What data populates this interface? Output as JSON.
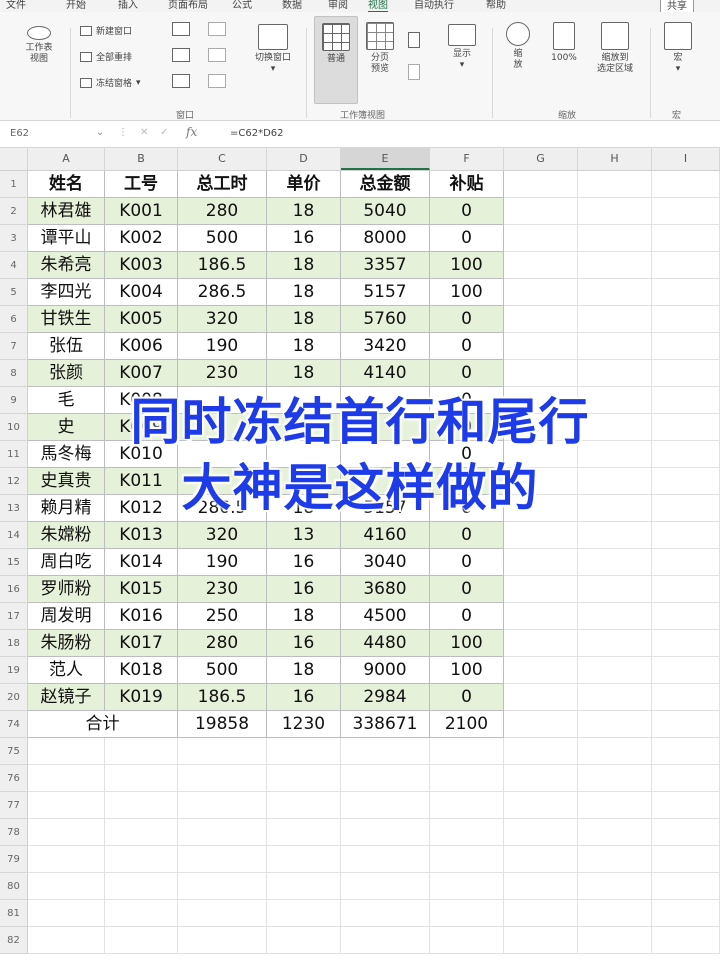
{
  "ribbon": {
    "tabs": [
      "文件",
      "开始",
      "插入",
      "页面布局",
      "公式",
      "数据",
      "审阅",
      "视图",
      "自动执行",
      "帮助"
    ],
    "active_tab": "视图",
    "right_button": "共享",
    "buttons": {
      "sheet_view": "工作表\n视图",
      "new_window": "新建窗口",
      "arrange_all": "全部重排",
      "freeze_panes": "冻结窗格",
      "switch_window": "切换窗口",
      "normal": "普通",
      "page_break": "分页\n预览",
      "show": "显示",
      "zoom": "缩\n放",
      "zoom_100": "100%",
      "zoom_selection": "缩放到\n选定区域",
      "macros": "宏"
    },
    "groups": {
      "window": "窗口",
      "workbook_views": "工作簿视图",
      "zoom": "缩放",
      "macros": "宏"
    }
  },
  "formula_bar": {
    "name_box": "E62",
    "fx": "fx",
    "formula": "=C62*D62"
  },
  "sheet": {
    "column_letters": [
      "A",
      "B",
      "C",
      "D",
      "E",
      "F",
      "G",
      "H",
      "I"
    ],
    "header_row_number": "1",
    "headers": [
      "姓名",
      "工号",
      "总工时",
      "单价",
      "总金额",
      "补贴"
    ],
    "rows": [
      {
        "n": "2",
        "cells": [
          "林君雄",
          "K001",
          "280",
          "18",
          "5040",
          "0"
        ]
      },
      {
        "n": "3",
        "cells": [
          "谭平山",
          "K002",
          "500",
          "16",
          "8000",
          "0"
        ]
      },
      {
        "n": "4",
        "cells": [
          "朱希亮",
          "K003",
          "186.5",
          "18",
          "3357",
          "100"
        ]
      },
      {
        "n": "5",
        "cells": [
          "李四光",
          "K004",
          "286.5",
          "18",
          "5157",
          "100"
        ]
      },
      {
        "n": "6",
        "cells": [
          "甘铁生",
          "K005",
          "320",
          "18",
          "5760",
          "0"
        ]
      },
      {
        "n": "7",
        "cells": [
          "张伍",
          "K006",
          "190",
          "18",
          "3420",
          "0"
        ]
      },
      {
        "n": "8",
        "cells": [
          "张颜",
          "K007",
          "230",
          "18",
          "4140",
          "0"
        ]
      },
      {
        "n": "9",
        "cells": [
          "毛",
          "K008",
          "",
          "",
          "",
          "0"
        ]
      },
      {
        "n": "10",
        "cells": [
          "史",
          "K009",
          "",
          "",
          "",
          "0"
        ]
      },
      {
        "n": "11",
        "cells": [
          "馬冬梅",
          "K010",
          "",
          "",
          "",
          "0"
        ]
      },
      {
        "n": "12",
        "cells": [
          "史真贵",
          "K011",
          "",
          "",
          "",
          "0"
        ]
      },
      {
        "n": "13",
        "cells": [
          "赖月精",
          "K012",
          "286.5",
          "18",
          "5157",
          "0"
        ]
      },
      {
        "n": "14",
        "cells": [
          "朱嫦粉",
          "K013",
          "320",
          "13",
          "4160",
          "0"
        ]
      },
      {
        "n": "15",
        "cells": [
          "周白吃",
          "K014",
          "190",
          "16",
          "3040",
          "0"
        ]
      },
      {
        "n": "16",
        "cells": [
          "罗师粉",
          "K015",
          "230",
          "16",
          "3680",
          "0"
        ]
      },
      {
        "n": "17",
        "cells": [
          "周发明",
          "K016",
          "250",
          "18",
          "4500",
          "0"
        ]
      },
      {
        "n": "18",
        "cells": [
          "朱肠粉",
          "K017",
          "280",
          "16",
          "4480",
          "100"
        ]
      },
      {
        "n": "19",
        "cells": [
          "范人",
          "K018",
          "500",
          "18",
          "9000",
          "100"
        ]
      },
      {
        "n": "20",
        "cells": [
          "赵镜子",
          "K019",
          "186.5",
          "16",
          "2984",
          "0"
        ]
      }
    ],
    "total_row": {
      "n": "74",
      "label": "合计",
      "values": [
        "19858",
        "1230",
        "338671",
        "2100"
      ]
    },
    "empty_rows": [
      "75",
      "76",
      "77",
      "78",
      "79",
      "80",
      "81",
      "82"
    ]
  },
  "overlay": {
    "line1": "同时冻结首行和尾行",
    "line2": "大神是这样做的"
  },
  "colors": {
    "band_green": "#e6f1d9",
    "overlay_blue": "#1d3be8",
    "excel_green": "#217346"
  }
}
